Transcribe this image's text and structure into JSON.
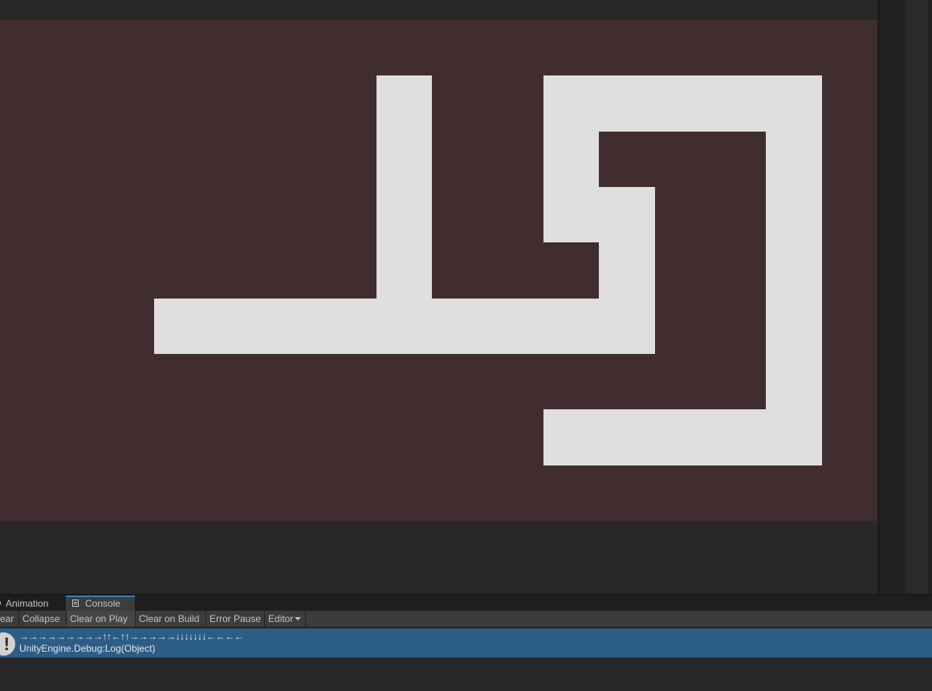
{
  "tabs": [
    {
      "label": "Animation",
      "active": false
    },
    {
      "label": "Console",
      "active": true
    }
  ],
  "toolbar": {
    "clear": "ear",
    "collapse": "Collapse",
    "clear_on_play": "Clear on Play",
    "clear_on_build": "Clear on Build",
    "error_pause": "Error Pause",
    "editor": "Editor"
  },
  "log": {
    "message": "→→→→→→→→→↑↑←↑↑→→→→→↓↓↓↓↓↓↓←←←←",
    "stack": "UnityEngine.Debug:Log(Object)",
    "icon": "!"
  },
  "colors": {
    "game_background": "#412d30",
    "wall": "#dfdfdf",
    "editor_background": "#282828",
    "log_selected": "#2c5d87",
    "tab_active_accent": "#3a79bb"
  }
}
